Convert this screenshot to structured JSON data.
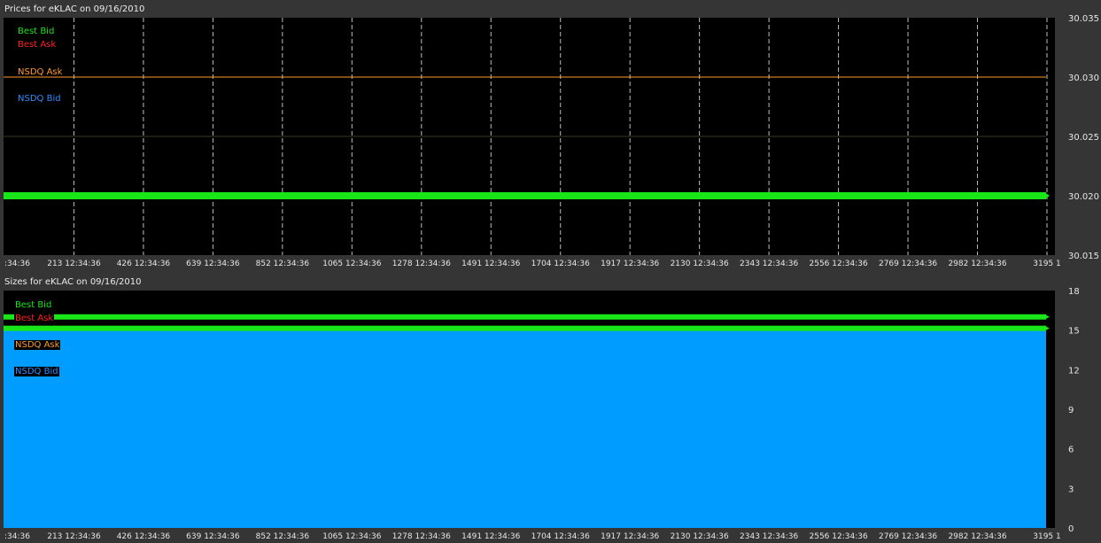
{
  "colors": {
    "best_bid": "#19e619",
    "best_ask": "#ff2020",
    "nsdq_ask": "#ff9a2a",
    "nsdq_bid": "#2f8cff",
    "size_fill": "#009cff"
  },
  "x_tick_labels": [
    ":34:36",
    "213 12:34:36",
    "426 12:34:36",
    "639 12:34:36",
    "852 12:34:36",
    "1065 12:34:36",
    "1278 12:34:36",
    "1491 12:34:36",
    "1704 12:34:36",
    "1917 12:34:36",
    "2130 12:34:36",
    "2343 12:34:36",
    "2556 12:34:36",
    "2769 12:34:36",
    "2982 12:34:36",
    "3195 1"
  ],
  "chart_data": [
    {
      "type": "line",
      "title": "Prices for  eKLAC  on  09/16/2010",
      "legend": [
        "Best Bid",
        "Best Ask",
        "NSDQ Ask",
        "NSDQ Bid"
      ],
      "legend_placement": "top-left",
      "grid": true,
      "x": [
        0,
        213,
        426,
        639,
        852,
        1065,
        1278,
        1491,
        1704,
        1917,
        2130,
        2343,
        2556,
        2769,
        2982,
        3195
      ],
      "ylim": [
        30.015,
        30.035
      ],
      "y_ticks": [
        "30.035",
        "30.030",
        "30.025",
        "30.020",
        "30.015"
      ],
      "series": [
        {
          "name": "Best Bid",
          "value": 30.02
        },
        {
          "name": "NSDQ Ask",
          "value": 30.03
        }
      ]
    },
    {
      "type": "area",
      "title": "Sizes for  eKLAC  on  09/16/2010",
      "legend": [
        "Best Bid",
        "Best Ask",
        "NSDQ Ask",
        "NSDQ Bid"
      ],
      "legend_placement": "top-left",
      "grid": false,
      "x": [
        0,
        213,
        426,
        639,
        852,
        1065,
        1278,
        1491,
        1704,
        1917,
        2130,
        2343,
        2556,
        2769,
        2982,
        3195
      ],
      "ylim": [
        0,
        18
      ],
      "y_ticks": [
        "18",
        "15",
        "12",
        "9",
        "6",
        "3",
        "0"
      ],
      "series": [
        {
          "name": "Best Bid",
          "value": 16
        },
        {
          "name": "Best Ask",
          "value": 16
        },
        {
          "name": "NSDQ Ask",
          "value": 15
        },
        {
          "name": "NSDQ Bid",
          "value": 15
        }
      ]
    }
  ]
}
